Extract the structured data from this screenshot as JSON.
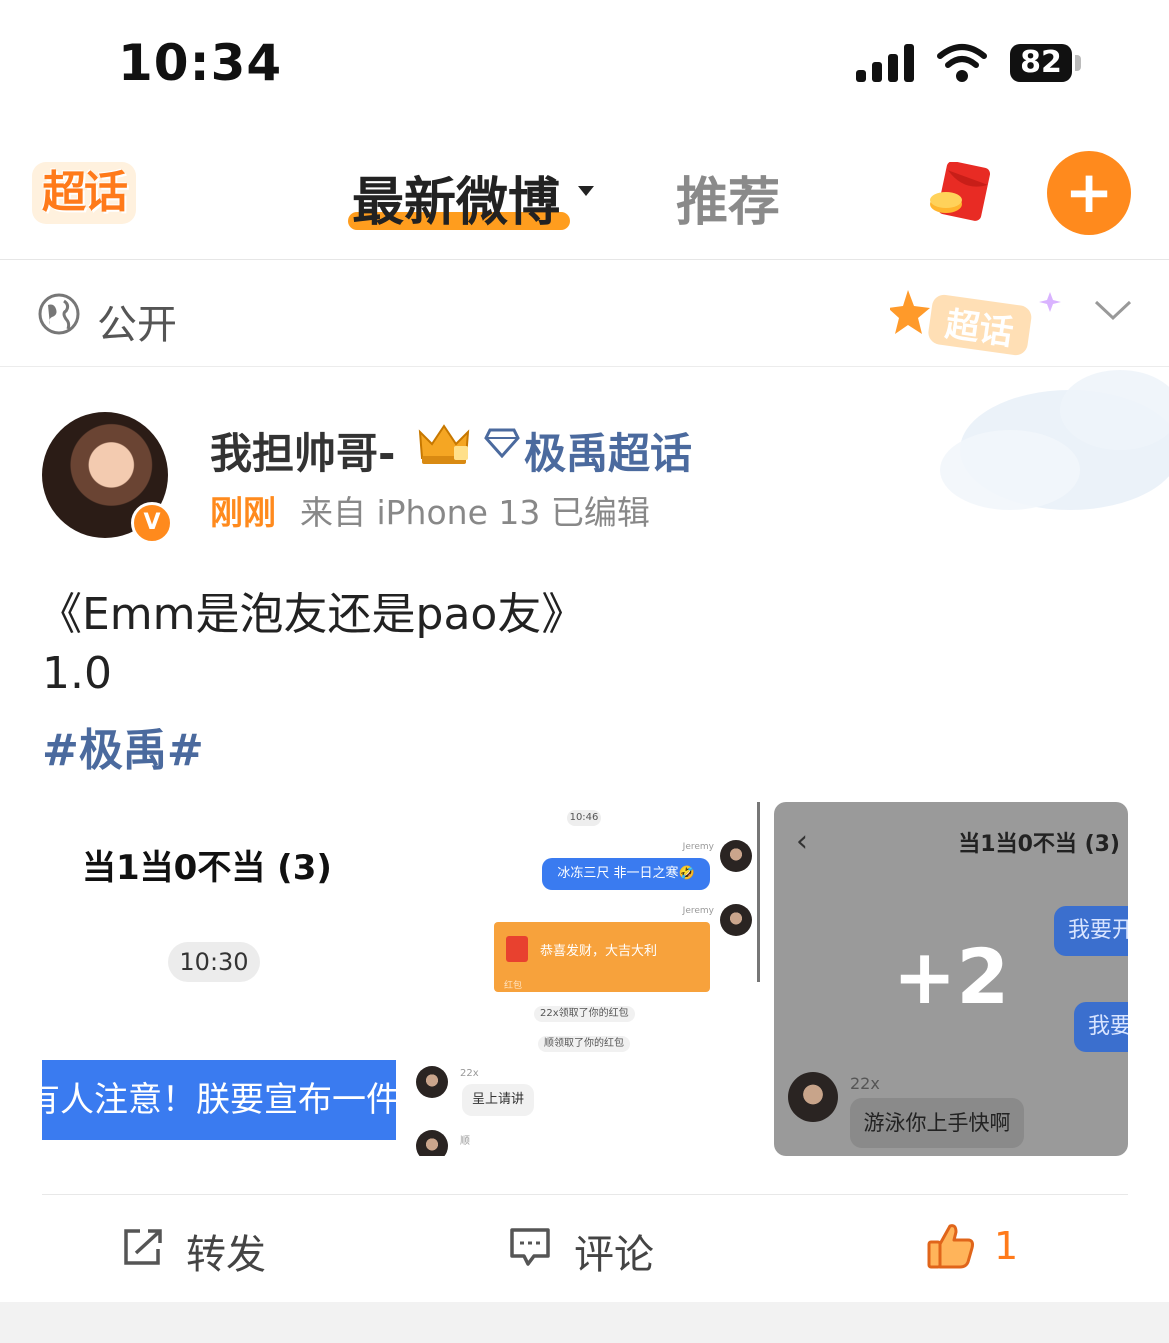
{
  "status_bar": {
    "time": "10:34",
    "battery": "82"
  },
  "header": {
    "logo_text": "超话",
    "tabs": [
      {
        "label": "最新微博",
        "active": true
      },
      {
        "label": "推荐",
        "active": false
      }
    ],
    "add_label": "+"
  },
  "visibility": {
    "label": "公开"
  },
  "post": {
    "username": "我担帅哥-",
    "supertopic": "极禹超话",
    "time": "刚刚",
    "source": "来自 iPhone 13  已编辑",
    "verified_badge": "V",
    "title": "《Emm是泡友还是pao友》",
    "version": "1.0",
    "hashtag": "#极禹#",
    "images": {
      "img1": {
        "title": "当1当0不当 (3)",
        "time": "10:30",
        "banner": "有人注意！朕要宣布一件"
      },
      "img2": {
        "time": "10:46",
        "sender1": "Jeremy",
        "bubble1": "冰冻三尺 非一日之寒🤣",
        "sender2": "Jeremy",
        "card_text": "恭喜发财，大吉大利",
        "card_sub": "红包",
        "pill1": "22x领取了你的红包",
        "pill2": "顺领取了你的红包",
        "name22": "22x",
        "bubble2": "呈上请讲",
        "name_s": "顺"
      },
      "img3": {
        "back": "‹",
        "title": "当1当0不当 (3)",
        "bubble1": "我要开",
        "bubble2": "我要",
        "more_count": "+2",
        "name": "22x",
        "bubble3": "游泳你上手快啊"
      }
    },
    "actions": {
      "repost": "转发",
      "comment": "评论",
      "like_count": "1"
    }
  },
  "colors": {
    "accent": "#ff8a1d",
    "link": "#4b6a9e"
  }
}
